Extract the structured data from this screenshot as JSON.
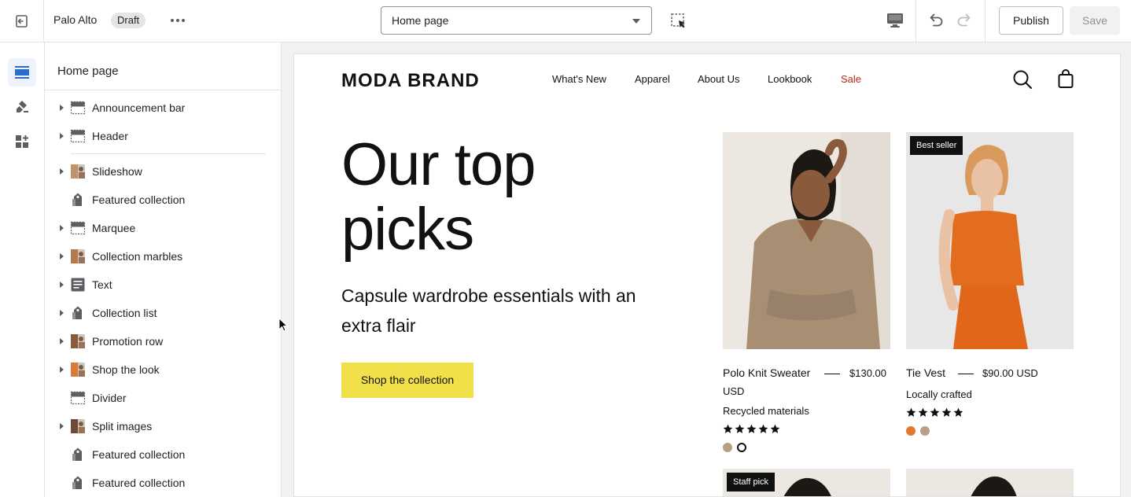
{
  "topbar": {
    "store_name": "Palo Alto",
    "status_badge": "Draft",
    "page_select": "Home page",
    "publish_label": "Publish",
    "save_label": "Save"
  },
  "rail": {
    "items": [
      {
        "icon": "sections-icon",
        "active": true
      },
      {
        "icon": "theme-settings-icon",
        "active": false
      },
      {
        "icon": "apps-icon",
        "active": false
      }
    ]
  },
  "sidebar": {
    "title": "Home page",
    "sections": [
      {
        "label": "Announcement bar",
        "icon": "layout-icon",
        "expandable": true
      },
      {
        "label": "Header",
        "icon": "layout-icon",
        "expandable": true
      },
      {
        "label": "Slideshow",
        "icon": "image-thumb-icon",
        "expandable": true
      },
      {
        "label": "Featured collection",
        "icon": "tag-icon",
        "expandable": false
      },
      {
        "label": "Marquee",
        "icon": "layout-icon",
        "expandable": true
      },
      {
        "label": "Collection marbles",
        "icon": "image-thumb-icon",
        "expandable": true
      },
      {
        "label": "Text",
        "icon": "text-icon",
        "expandable": true
      },
      {
        "label": "Collection list",
        "icon": "tag-icon",
        "expandable": true
      },
      {
        "label": "Promotion row",
        "icon": "image-thumb-icon",
        "expandable": true
      },
      {
        "label": "Shop the look",
        "icon": "image-thumb-icon",
        "expandable": true
      },
      {
        "label": "Divider",
        "icon": "layout-icon",
        "expandable": false
      },
      {
        "label": "Split images",
        "icon": "image-thumb-icon",
        "expandable": true
      },
      {
        "label": "Featured collection",
        "icon": "tag-icon",
        "expandable": false
      },
      {
        "label": "Featured collection",
        "icon": "tag-icon",
        "expandable": false
      }
    ]
  },
  "preview": {
    "brand": "MODA BRAND",
    "nav": [
      "What's New",
      "Apparel",
      "About Us",
      "Lookbook",
      "Sale"
    ],
    "sale_color": "#b3261e",
    "hero": {
      "title": "Our top picks",
      "subtitle": "Capsule wardrobe essentials with an extra flair",
      "cta": "Shop the collection",
      "cta_color": "#f1e04a"
    },
    "products": [
      {
        "name": "Polo Knit Sweater",
        "price": "$130.00",
        "currency": "USD",
        "meta": "Recycled materials",
        "rating": 5,
        "swatches": [
          "#b79f84",
          "#ffffff"
        ],
        "badge": ""
      },
      {
        "name": "Tie Vest",
        "price": "$90.00 USD",
        "currency": "",
        "meta": "Locally crafted",
        "rating": 5,
        "swatches": [
          "#e07a2e",
          "#b79f84"
        ],
        "badge": "Best seller"
      }
    ],
    "lower_badge": "Staff pick"
  }
}
